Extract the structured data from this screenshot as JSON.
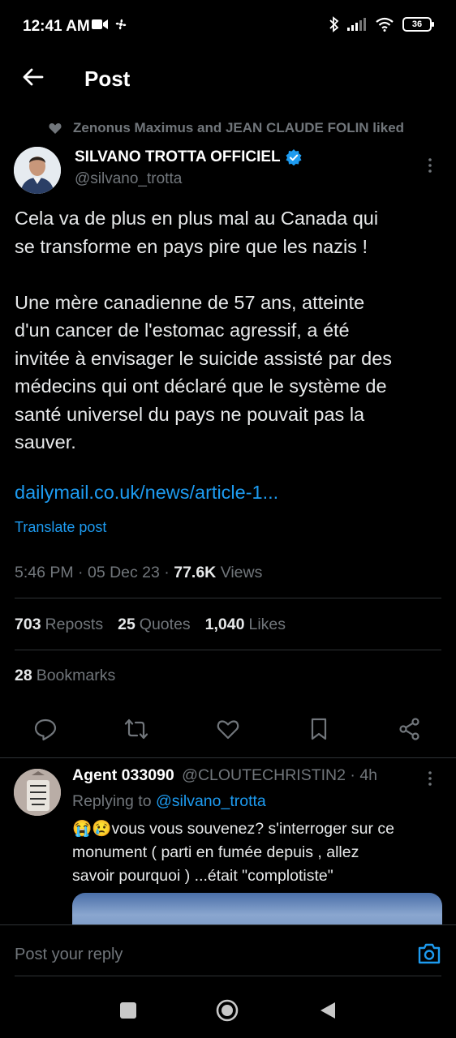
{
  "status_bar": {
    "time": "12:41 AM",
    "battery": "36",
    "icons": [
      "video-camera-icon",
      "fan-icon",
      "bluetooth-icon",
      "signal-icon",
      "wifi-icon",
      "battery-icon"
    ]
  },
  "header": {
    "title": "Post",
    "back_icon": "arrow-left-icon"
  },
  "post": {
    "social_context": "Zenonus Maximus and JEAN CLAUDE FOLIN liked",
    "author_name": "SILVANO TROTTA OFFICIEL",
    "verified": true,
    "handle": "@silvano_trotta",
    "text_p1_l1": "Cela va de plus en plus mal au Canada qui",
    "text_p1_l2": "se transforme en pays pire que les nazis !",
    "text_p2_l1": "Une mère canadienne de 57 ans, atteinte",
    "text_p2_l2": "d'un cancer de l'estomac agressif, a été",
    "text_p2_l3": "invitée à envisager le suicide assisté par des",
    "text_p2_l4": "médecins qui ont déclaré que le système de",
    "text_p2_l5": "santé universel du pays ne pouvait pas la",
    "text_p2_l6": "sauver.",
    "link": "dailymail.co.uk/news/article-1...",
    "translate": "Translate post",
    "time": "5:46 PM",
    "date": "05 Dec 23",
    "views_count": "77.6K",
    "views_label": "Views",
    "reposts_count": "703",
    "reposts_label": "Reposts",
    "quotes_count": "25",
    "quotes_label": "Quotes",
    "likes_count": "1,040",
    "likes_label": "Likes",
    "bookmarks_count": "28",
    "bookmarks_label": "Bookmarks"
  },
  "reply": {
    "name": "Agent 033090",
    "handle": "@CLOUTECHRISTIN2",
    "time": "4h",
    "replying_prefix": "Replying to",
    "replying_to": "@silvano_trotta",
    "text_l1": "😭😢vous vous souvenez?  s'interroger sur ce",
    "text_l2": "monument ( parti en fumée depuis , allez",
    "text_l3": "savoir pourquoi ) ...était \"complotiste\""
  },
  "composer": {
    "placeholder": "Post your reply"
  },
  "colors": {
    "background": "#000000",
    "accent": "#1d9bf0",
    "muted": "#71767b",
    "text": "#e7e9ea",
    "divider": "#2f3336"
  }
}
